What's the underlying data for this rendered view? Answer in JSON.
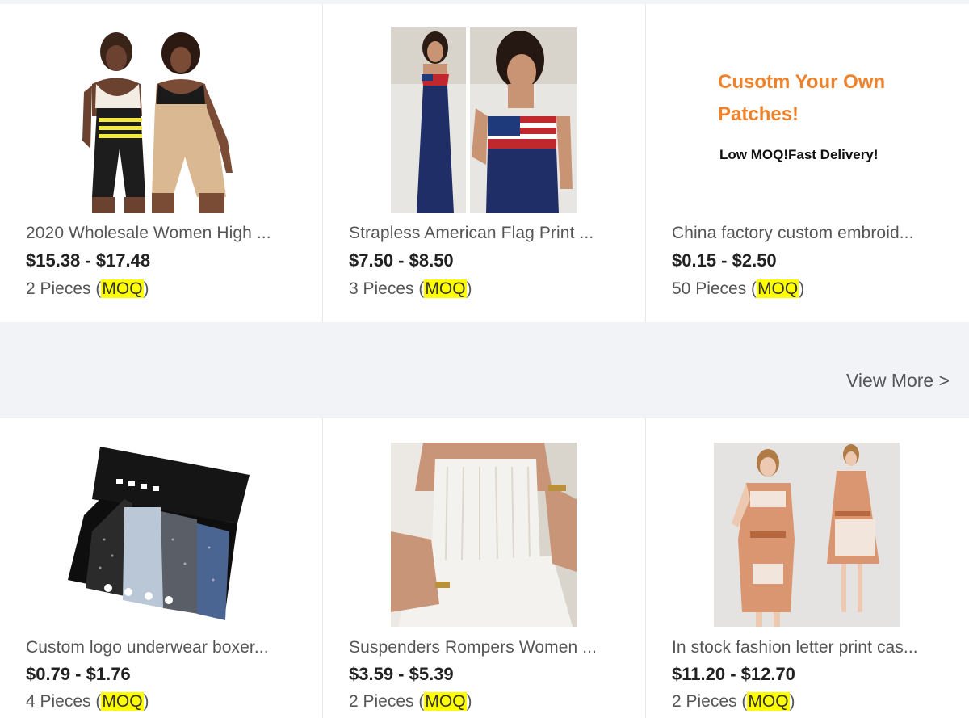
{
  "products_top": [
    {
      "title": "2020 Wholesale Women High ...",
      "price": "$15.38 - $17.48",
      "moq_qty": "2 Pieces (",
      "moq_label": "MOQ",
      "moq_close": ")"
    },
    {
      "title": "Strapless American Flag Print ...",
      "price": "$7.50 - $8.50",
      "moq_qty": "3 Pieces (",
      "moq_label": "MOQ",
      "moq_close": ")"
    },
    {
      "title": "China factory custom embroid...",
      "price": "$0.15 - $2.50",
      "moq_qty": "50 Pieces (",
      "moq_label": "MOQ",
      "moq_close": ")",
      "image_text_1": "Cusotm Your Own",
      "image_text_2": "Patches!",
      "image_text_3": "Low MOQ!Fast Delivery!"
    }
  ],
  "view_more": "View More >",
  "products_bottom": [
    {
      "title": "Custom logo underwear boxer...",
      "price": "$0.79 - $1.76",
      "moq_qty": "4 Pieces (",
      "moq_label": "MOQ",
      "moq_close": ")"
    },
    {
      "title": "Suspenders Rompers Women ...",
      "price": "$3.59 - $5.39",
      "moq_qty": "2 Pieces (",
      "moq_label": "MOQ",
      "moq_close": ")"
    },
    {
      "title": "In stock fashion letter print cas...",
      "price": "$11.20 - $12.70",
      "moq_qty": "2 Pieces (",
      "moq_label": "MOQ",
      "moq_close": ")"
    }
  ],
  "colors": {
    "highlight": "#ffff00",
    "patch_orange": "#f0812b",
    "background": "#f2f3f7"
  }
}
